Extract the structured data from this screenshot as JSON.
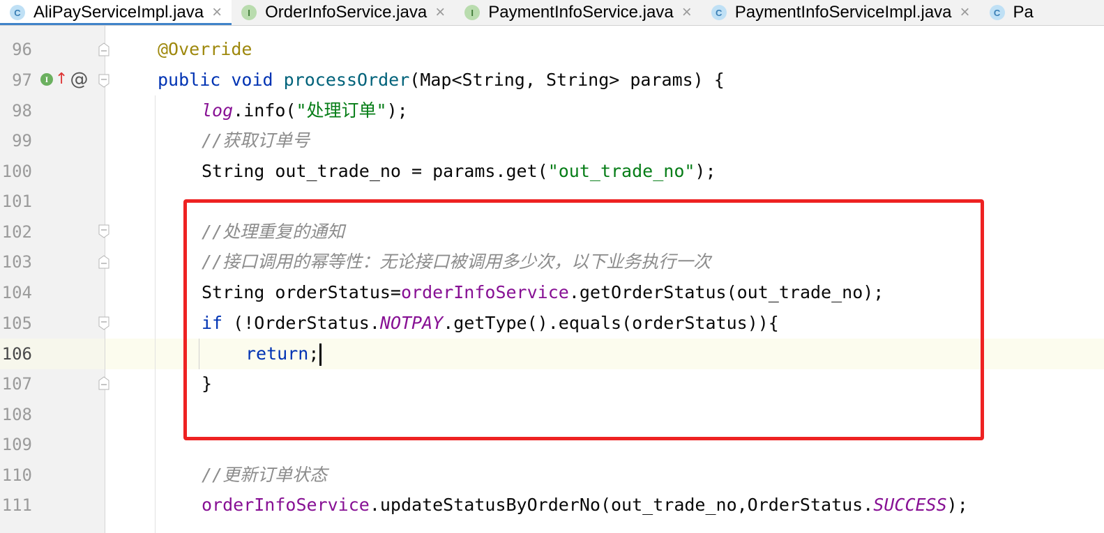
{
  "tabs": [
    {
      "label": "AliPayServiceImpl.java",
      "icon": "class-icon",
      "icon_letter": "C",
      "active": true
    },
    {
      "label": "OrderInfoService.java",
      "icon": "interface-icon",
      "icon_letter": "I",
      "active": false
    },
    {
      "label": "PaymentInfoService.java",
      "icon": "interface-icon",
      "icon_letter": "I",
      "active": false
    },
    {
      "label": "PaymentInfoServiceImpl.java",
      "icon": "class-icon",
      "icon_letter": "C",
      "active": false
    },
    {
      "label": "Pa",
      "icon": "class-icon",
      "icon_letter": "C",
      "active": false
    }
  ],
  "close_glyph": "×",
  "gutter_markers": {
    "implements_letter": "I",
    "arrow": "↑",
    "at": "@"
  },
  "lines": [
    {
      "num": "96"
    },
    {
      "num": "97"
    },
    {
      "num": "98"
    },
    {
      "num": "99"
    },
    {
      "num": "100"
    },
    {
      "num": "101"
    },
    {
      "num": "102"
    },
    {
      "num": "103"
    },
    {
      "num": "104"
    },
    {
      "num": "105"
    },
    {
      "num": "106"
    },
    {
      "num": "107"
    },
    {
      "num": "108"
    },
    {
      "num": "109"
    },
    {
      "num": "110"
    },
    {
      "num": "111"
    }
  ],
  "code": {
    "l96_ann": "@Override",
    "l97_kw1": "public",
    "l97_kw2": "void",
    "l97_fn": "processOrder",
    "l97_rest": "(Map<String, String> params) {",
    "l98_field": "log",
    "l98_mid": ".info(",
    "l98_str": "\"处理订单\"",
    "l98_end": ");",
    "l99_cmt": "//获取订单号",
    "l100_pre": "String out_trade_no = params.get(",
    "l100_str": "\"out_trade_no\"",
    "l100_end": ");",
    "l102_cmt": "//处理重复的通知",
    "l103_cmt": "//接口调用的幂等性：无论接口被调用多少次，以下业务执行一次",
    "l104_pre": "String orderStatus=",
    "l104_field": "orderInfoService",
    "l104_end": ".getOrderStatus(out_trade_no);",
    "l105_kw": "if",
    "l105_pre": " (!OrderStatus.",
    "l105_sfield": "NOTPAY",
    "l105_end": ".getType().equals(orderStatus)){",
    "l106_kw": "return",
    "l106_end": ";",
    "l107_brace": "}",
    "l110_cmt": "//更新订单状态",
    "l111_field": "orderInfoService",
    "l111_mid": ".updateStatusByOrderNo(out_trade_no,OrderStatus.",
    "l111_sfield": "SUCCESS",
    "l111_end": ");"
  },
  "colors": {
    "keyword": "#0033b3",
    "annotation": "#9e880d",
    "method": "#00627a",
    "string": "#067d17",
    "comment": "#8c8c8c",
    "field": "#871094",
    "highlight_box": "#ee2222",
    "active_tab_underline": "#4083c9"
  }
}
